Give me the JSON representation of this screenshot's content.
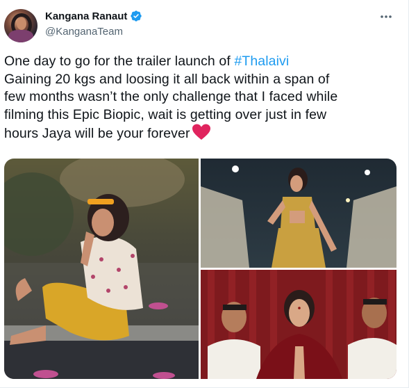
{
  "author": {
    "display_name": "Kangana Ranaut",
    "handle": "@KanganaTeam",
    "verified": true,
    "avatar_icon": "profile-avatar"
  },
  "tweet": {
    "lines": [
      "One day to go for the trailer launch of ",
      "Gaining 20 kgs and loosing it all back within a span of",
      "few months wasn’t the only challenge that I faced while",
      "filming this Epic Biopic, wait is getting over just in few",
      "hours Jaya will be your forever"
    ],
    "hashtag": "#Thalaivi",
    "emoji": "red-heart"
  },
  "colors": {
    "link": "#1d9bf0",
    "text": "#0f1419",
    "secondary": "#536471",
    "verified": "#1d9bf0",
    "heart": "#e0245e"
  },
  "media": [
    {
      "name": "photo-yellow-shorts",
      "description_icon": "image"
    },
    {
      "name": "photo-dance-costume",
      "description_icon": "image"
    },
    {
      "name": "photo-namaste-red-sari",
      "description_icon": "image"
    }
  ],
  "icons": {
    "more": "more-horizontal-icon",
    "verified": "verified-badge-icon"
  }
}
